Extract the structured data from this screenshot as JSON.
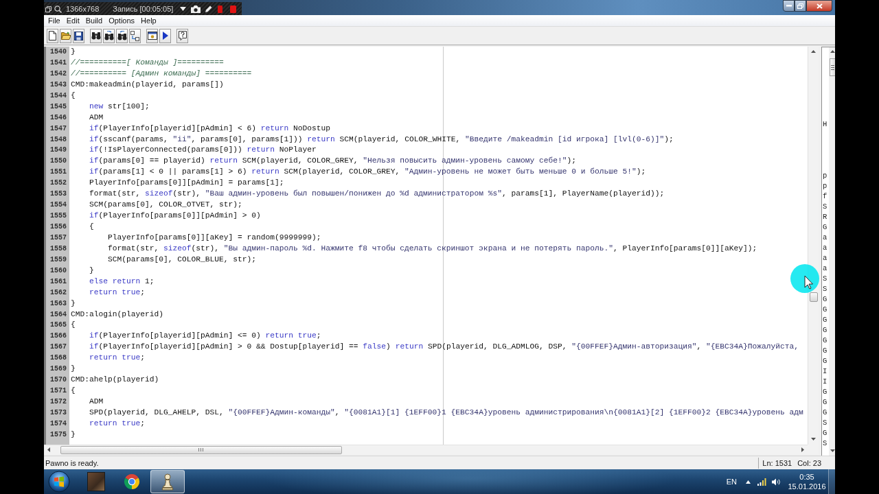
{
  "recorder": {
    "resolution": "1366x768",
    "status": "Запись [00:05:05]"
  },
  "menu": [
    "File",
    "Edit",
    "Build",
    "Options",
    "Help"
  ],
  "editor": {
    "lines": [
      {
        "number": "1540",
        "segments": [
          {
            "kind": "plain",
            "text": "}"
          }
        ]
      },
      {
        "number": "1541",
        "segments": [
          {
            "kind": "comment",
            "text": "//==========[ Команды ]=========="
          }
        ]
      },
      {
        "number": "1542",
        "segments": [
          {
            "kind": "comment",
            "text": "//========== [Админ команды] =========="
          }
        ]
      },
      {
        "number": "1543",
        "segments": [
          {
            "kind": "plain",
            "text": "CMD:makeadmin(playerid, params[])"
          }
        ]
      },
      {
        "number": "1544",
        "segments": [
          {
            "kind": "plain",
            "text": "{"
          }
        ]
      },
      {
        "number": "1545",
        "segments": [
          {
            "kind": "keyword",
            "text": "    new"
          },
          {
            "kind": "plain",
            "text": " str[100];"
          }
        ]
      },
      {
        "number": "1546",
        "segments": [
          {
            "kind": "plain",
            "text": "    ADM"
          }
        ]
      },
      {
        "number": "1547",
        "segments": [
          {
            "kind": "keyword",
            "text": "    if"
          },
          {
            "kind": "plain",
            "text": "(PlayerInfo[playerid][pAdmin] < 6) "
          },
          {
            "kind": "keyword",
            "text": "return"
          },
          {
            "kind": "plain",
            "text": " NoDostup"
          }
        ]
      },
      {
        "number": "1548",
        "segments": [
          {
            "kind": "keyword",
            "text": "    if"
          },
          {
            "kind": "plain",
            "text": "(sscanf(params, "
          },
          {
            "kind": "string",
            "text": "\"ii\""
          },
          {
            "kind": "plain",
            "text": ", params[0], params[1])) "
          },
          {
            "kind": "keyword",
            "text": "return"
          },
          {
            "kind": "plain",
            "text": " SCM(playerid, COLOR_WHITE, "
          },
          {
            "kind": "string",
            "text": "\"Введите /makeadmin [id игрока] [lvl(0-6)]\""
          },
          {
            "kind": "plain",
            "text": ");"
          }
        ]
      },
      {
        "number": "1549",
        "segments": [
          {
            "kind": "keyword",
            "text": "    if"
          },
          {
            "kind": "plain",
            "text": "(!IsPlayerConnected(params[0])) "
          },
          {
            "kind": "keyword",
            "text": "return"
          },
          {
            "kind": "plain",
            "text": " NoPlayer"
          }
        ]
      },
      {
        "number": "1550",
        "segments": [
          {
            "kind": "keyword",
            "text": "    if"
          },
          {
            "kind": "plain",
            "text": "(params[0] == playerid) "
          },
          {
            "kind": "keyword",
            "text": "return"
          },
          {
            "kind": "plain",
            "text": " SCM(playerid, COLOR_GREY, "
          },
          {
            "kind": "string",
            "text": "\"Нельзя повысить админ-уровень самому себе!\""
          },
          {
            "kind": "plain",
            "text": ");"
          }
        ]
      },
      {
        "number": "1551",
        "segments": [
          {
            "kind": "keyword",
            "text": "    if"
          },
          {
            "kind": "plain",
            "text": "(params[1] < 0 || params[1] > 6) "
          },
          {
            "kind": "keyword",
            "text": "return"
          },
          {
            "kind": "plain",
            "text": " SCM(playerid, COLOR_GREY, "
          },
          {
            "kind": "string",
            "text": "\"Админ-уровень не может быть меньше 0 и больше 5!\""
          },
          {
            "kind": "plain",
            "text": ");"
          }
        ]
      },
      {
        "number": "1552",
        "segments": [
          {
            "kind": "plain",
            "text": "    PlayerInfo[params[0]][pAdmin] = params[1];"
          }
        ]
      },
      {
        "number": "1553",
        "segments": [
          {
            "kind": "plain",
            "text": "    format(str, "
          },
          {
            "kind": "keyword",
            "text": "sizeof"
          },
          {
            "kind": "plain",
            "text": "(str), "
          },
          {
            "kind": "string",
            "text": "\"Ваш админ-уровень был повышен/понижен до %d администратором %s\""
          },
          {
            "kind": "plain",
            "text": ", params[1], PlayerName(playerid));"
          }
        ]
      },
      {
        "number": "1554",
        "segments": [
          {
            "kind": "plain",
            "text": "    SCM(params[0], COLOR_OTVET, str);"
          }
        ]
      },
      {
        "number": "1555",
        "segments": [
          {
            "kind": "keyword",
            "text": "    if"
          },
          {
            "kind": "plain",
            "text": "(PlayerInfo[params[0]][pAdmin] > 0)"
          }
        ]
      },
      {
        "number": "1556",
        "segments": [
          {
            "kind": "plain",
            "text": "    {"
          }
        ]
      },
      {
        "number": "1557",
        "segments": [
          {
            "kind": "plain",
            "text": "        PlayerInfo[params[0]][aKey] = random(9999999);"
          }
        ]
      },
      {
        "number": "1558",
        "segments": [
          {
            "kind": "plain",
            "text": "        format(str, "
          },
          {
            "kind": "keyword",
            "text": "sizeof"
          },
          {
            "kind": "plain",
            "text": "(str), "
          },
          {
            "kind": "string",
            "text": "\"Вы админ-пароль %d. Нажмите f8 чтобы сделать скриншот экрана и не потерять пароль.\""
          },
          {
            "kind": "plain",
            "text": ", PlayerInfo[params[0]][aKey]);"
          }
        ]
      },
      {
        "number": "1559",
        "segments": [
          {
            "kind": "plain",
            "text": "        SCM(params[0], COLOR_BLUE, str);"
          }
        ]
      },
      {
        "number": "1560",
        "segments": [
          {
            "kind": "plain",
            "text": "    }"
          }
        ]
      },
      {
        "number": "1561",
        "segments": [
          {
            "kind": "keyword",
            "text": "    else return"
          },
          {
            "kind": "plain",
            "text": " 1;"
          }
        ]
      },
      {
        "number": "1562",
        "segments": [
          {
            "kind": "keyword",
            "text": "    return true"
          },
          {
            "kind": "plain",
            "text": ";"
          }
        ]
      },
      {
        "number": "1563",
        "segments": [
          {
            "kind": "plain",
            "text": "}"
          }
        ]
      },
      {
        "number": "1564",
        "segments": [
          {
            "kind": "plain",
            "text": "CMD:alogin(playerid)"
          }
        ]
      },
      {
        "number": "1565",
        "segments": [
          {
            "kind": "plain",
            "text": "{"
          }
        ]
      },
      {
        "number": "1566",
        "segments": [
          {
            "kind": "keyword",
            "text": "    if"
          },
          {
            "kind": "plain",
            "text": "(PlayerInfo[playerid][pAdmin] <= 0) "
          },
          {
            "kind": "keyword",
            "text": "return true"
          },
          {
            "kind": "plain",
            "text": ";"
          }
        ]
      },
      {
        "number": "1567",
        "segments": [
          {
            "kind": "keyword",
            "text": "    if"
          },
          {
            "kind": "plain",
            "text": "(PlayerInfo[playerid][pAdmin] > 0 && Dostup[playerid] == "
          },
          {
            "kind": "keyword",
            "text": "false"
          },
          {
            "kind": "plain",
            "text": ") "
          },
          {
            "kind": "keyword",
            "text": "return"
          },
          {
            "kind": "plain",
            "text": " SPD(playerid, DLG_ADMLOG, DSP, "
          },
          {
            "kind": "string",
            "text": "\"{00FFEF}Админ-авторизация\""
          },
          {
            "kind": "plain",
            "text": ", "
          },
          {
            "kind": "string",
            "text": "\"{EBC34A}Пожалуйста,"
          }
        ]
      },
      {
        "number": "1568",
        "segments": [
          {
            "kind": "keyword",
            "text": "    return true"
          },
          {
            "kind": "plain",
            "text": ";"
          }
        ]
      },
      {
        "number": "1569",
        "segments": [
          {
            "kind": "plain",
            "text": "}"
          }
        ]
      },
      {
        "number": "1570",
        "segments": [
          {
            "kind": "plain",
            "text": "CMD:ahelp(playerid)"
          }
        ]
      },
      {
        "number": "1571",
        "segments": [
          {
            "kind": "plain",
            "text": "{"
          }
        ]
      },
      {
        "number": "1572",
        "segments": [
          {
            "kind": "plain",
            "text": "    ADM"
          }
        ]
      },
      {
        "number": "1573",
        "segments": [
          {
            "kind": "plain",
            "text": "    SPD(playerid, DLG_AHELP, DSL, "
          },
          {
            "kind": "string",
            "text": "\"{00FFEF}Админ-команды\""
          },
          {
            "kind": "plain",
            "text": ", "
          },
          {
            "kind": "string",
            "text": "\"{0081A1}[1] {1EFF00}1 {EBC34A}уровень администрирования\\n{0081A1}[2] {1EFF00}2 {EBC34A}уровень адм"
          }
        ]
      },
      {
        "number": "1574",
        "segments": [
          {
            "kind": "keyword",
            "text": "    return true"
          },
          {
            "kind": "plain",
            "text": ";"
          }
        ]
      },
      {
        "number": "1575",
        "segments": [
          {
            "kind": "plain",
            "text": "}"
          }
        ]
      }
    ]
  },
  "function_list": {
    "groups": [
      [
        "H"
      ],
      [
        "p",
        "p",
        "f",
        "S",
        "R",
        "G",
        "a",
        "a",
        "a",
        "a",
        "S",
        "S",
        "G",
        "G",
        "G",
        "G",
        "G",
        "G",
        "G",
        "I",
        "I",
        "G",
        "G",
        "G",
        "S",
        "G",
        "S"
      ]
    ]
  },
  "status_bar": {
    "message": "Pawno is ready.",
    "line": "Ln: 1531",
    "column": "Col: 23"
  },
  "taskbar": {
    "apps": [
      {
        "kind": "game",
        "selected": false
      },
      {
        "kind": "browser",
        "selected": false
      },
      {
        "kind": "pawno",
        "selected": true
      }
    ],
    "tray": {
      "language": "EN",
      "time": "0:35",
      "date": "15.01.2016"
    }
  }
}
